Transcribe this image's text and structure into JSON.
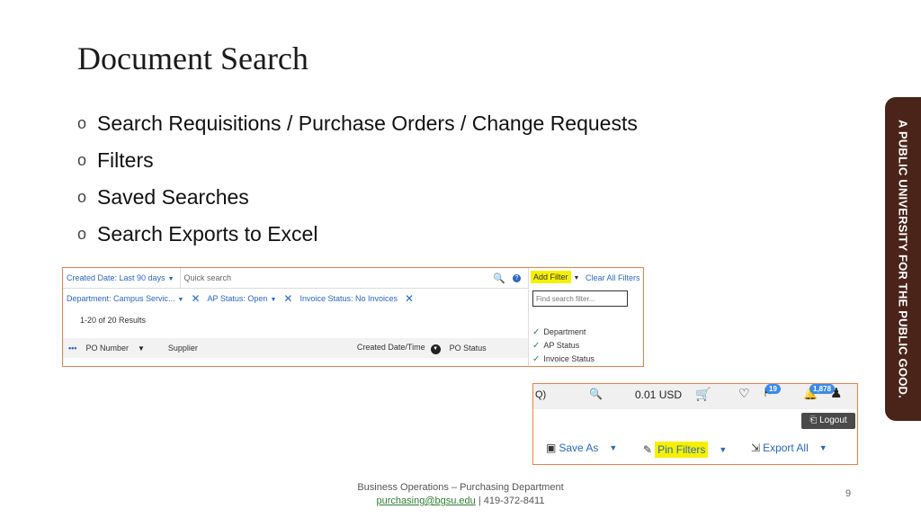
{
  "slide": {
    "title": "Document Search",
    "bullets": [
      "Search Requisitions / Purchase Orders / Change Requests",
      "Filters",
      "Saved Searches",
      "Search Exports to Excel"
    ],
    "side_tab": "A PUBLIC UNIVERSITY FOR THE PUBLIC GOOD.",
    "page_number": "9"
  },
  "search_panel": {
    "date_filter": "Created Date: Last 90 days",
    "search_placeholder": "Quick search",
    "add_filter": "Add Filter",
    "clear_filters": "Clear All Filters",
    "chips": [
      "Department: Campus Servic...",
      "AP Status: Open",
      "Invoice Status: No Invoices"
    ],
    "results": "1-20 of 20 Results",
    "columns": [
      "PO Number",
      "Supplier",
      "Created Date/Time",
      "PO Status"
    ],
    "find_placeholder": "Find search filter...",
    "filter_options": [
      "Department",
      "AP Status",
      "Invoice Status"
    ]
  },
  "toolbar": {
    "search_fragment": "Q)",
    "cart_amount": "0.01 USD",
    "notifications_count": "19",
    "messages_count": "1,878",
    "logout": "Logout",
    "save_as": "Save As",
    "pin_filters": "Pin Filters",
    "export_all": "Export All"
  },
  "footer": {
    "line1": "Business Operations – Purchasing Department",
    "email": "purchasing@bgsu.edu",
    "phone": "| 419-372-8411"
  },
  "colors": {
    "accent_border": "#e8804a",
    "link_blue": "#2b67c2",
    "highlight": "#f6f000",
    "tab_brown": "#4a2419"
  }
}
